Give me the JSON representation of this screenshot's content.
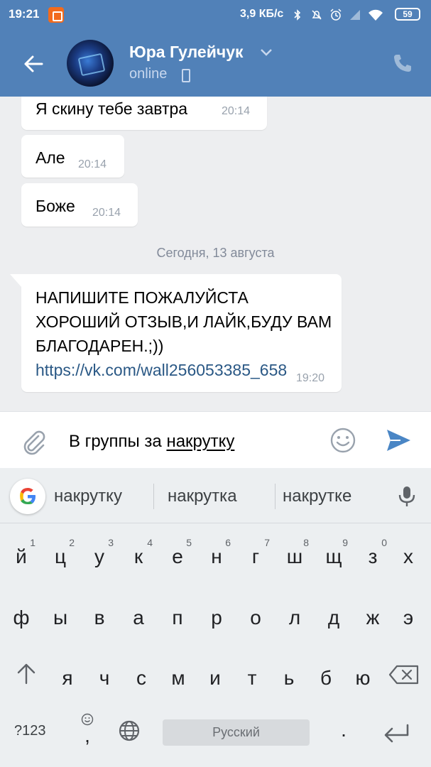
{
  "status_bar": {
    "time": "19:21",
    "speed": "3,9 КБ/с",
    "battery": "59",
    "icons": [
      "notification-icon",
      "bluetooth-icon",
      "mute-icon",
      "alarm-icon",
      "signal-icon",
      "wifi-icon",
      "battery-icon"
    ]
  },
  "header": {
    "contact_name": "Юра Гулейчук",
    "status": "online",
    "icons": [
      "back-arrow-icon",
      "avatar",
      "chevron-down-icon",
      "mobile-icon",
      "phone-icon"
    ]
  },
  "messages": [
    {
      "text": "Я скину тебе завтра",
      "time": "20:14"
    },
    {
      "text": "Але",
      "time": "20:14"
    },
    {
      "text": "Боже",
      "time": "20:14"
    }
  ],
  "date_divider": "Сегодня, 13 августа",
  "last_message": {
    "text": "НАПИШИТЕ ПОЖАЛУЙСТА ХОРОШИЙ ОТЗЫВ,И ЛАЙК,БУДУ ВАМ БЛАГОДАРЕН.;))",
    "link": "https://vk.com/wall256053385_658",
    "time": "19:20"
  },
  "composer": {
    "text_prefix": "В группы за ",
    "text_word": "накрутку",
    "icons": [
      "attach-icon",
      "emoji-icon",
      "send-icon"
    ]
  },
  "keyboard": {
    "suggestions": [
      "накрутку",
      "накрутка",
      "накрутке"
    ],
    "row1": [
      {
        "ch": "й",
        "hint": "1"
      },
      {
        "ch": "ц",
        "hint": "2"
      },
      {
        "ch": "у",
        "hint": "3"
      },
      {
        "ch": "к",
        "hint": "4"
      },
      {
        "ch": "е",
        "hint": "5"
      },
      {
        "ch": "н",
        "hint": "6"
      },
      {
        "ch": "г",
        "hint": "7"
      },
      {
        "ch": "ш",
        "hint": "8"
      },
      {
        "ch": "щ",
        "hint": "9"
      },
      {
        "ch": "з",
        "hint": "0"
      },
      {
        "ch": "х",
        "hint": ""
      }
    ],
    "row2": [
      "ф",
      "ы",
      "в",
      "а",
      "п",
      "р",
      "о",
      "л",
      "д",
      "ж",
      "э"
    ],
    "row3": [
      "я",
      "ч",
      "с",
      "м",
      "и",
      "т",
      "ь",
      "б",
      "ю"
    ],
    "symbols_key": "?123",
    "comma_key": ",",
    "space_label": "Русский",
    "period_key": ".",
    "icons": [
      "google-icon",
      "mic-icon",
      "shift-icon",
      "backspace-icon",
      "globe-icon",
      "enter-icon"
    ]
  },
  "colors": {
    "header_bg": "#5181b8",
    "chat_bg": "#edeef0",
    "link": "#2a5885",
    "send_accent": "#4a86c5"
  }
}
